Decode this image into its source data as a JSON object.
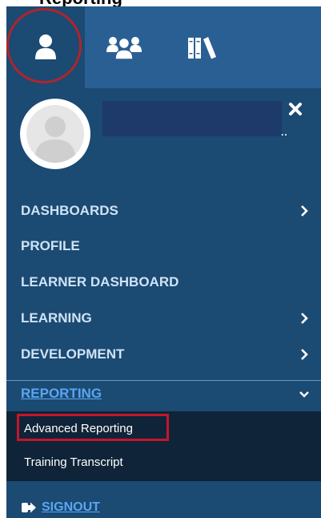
{
  "top_title": "Reporting",
  "colors": {
    "sidebar_bg": "#1b4a73",
    "tab_bg": "#2a5f94",
    "submenu_bg": "#0f2438",
    "nav_text": "#cfe3f5",
    "link_blue": "#5aa6f0",
    "highlight_red": "#c4162a"
  },
  "tabs": [
    {
      "icon": "user-icon",
      "active": true
    },
    {
      "icon": "group-icon",
      "active": false
    },
    {
      "icon": "library-icon",
      "active": false
    }
  ],
  "profile": {
    "name_redacted": true,
    "name_overflow": ".."
  },
  "nav": {
    "items": [
      {
        "label": "DASHBOARDS",
        "has_chevron": true
      },
      {
        "label": "PROFILE",
        "has_chevron": false
      },
      {
        "label": "LEARNER DASHBOARD",
        "has_chevron": false
      },
      {
        "label": "LEARNING",
        "has_chevron": true
      },
      {
        "label": "DEVELOPMENT",
        "has_chevron": true
      }
    ],
    "reporting": {
      "label": "REPORTING",
      "expanded": true
    },
    "reporting_sub": [
      {
        "label": "Advanced Reporting",
        "highlighted": true
      },
      {
        "label": "Training Transcript",
        "highlighted": false
      }
    ]
  },
  "signout": {
    "label": "SIGNOUT",
    "icon": "signout-icon"
  }
}
